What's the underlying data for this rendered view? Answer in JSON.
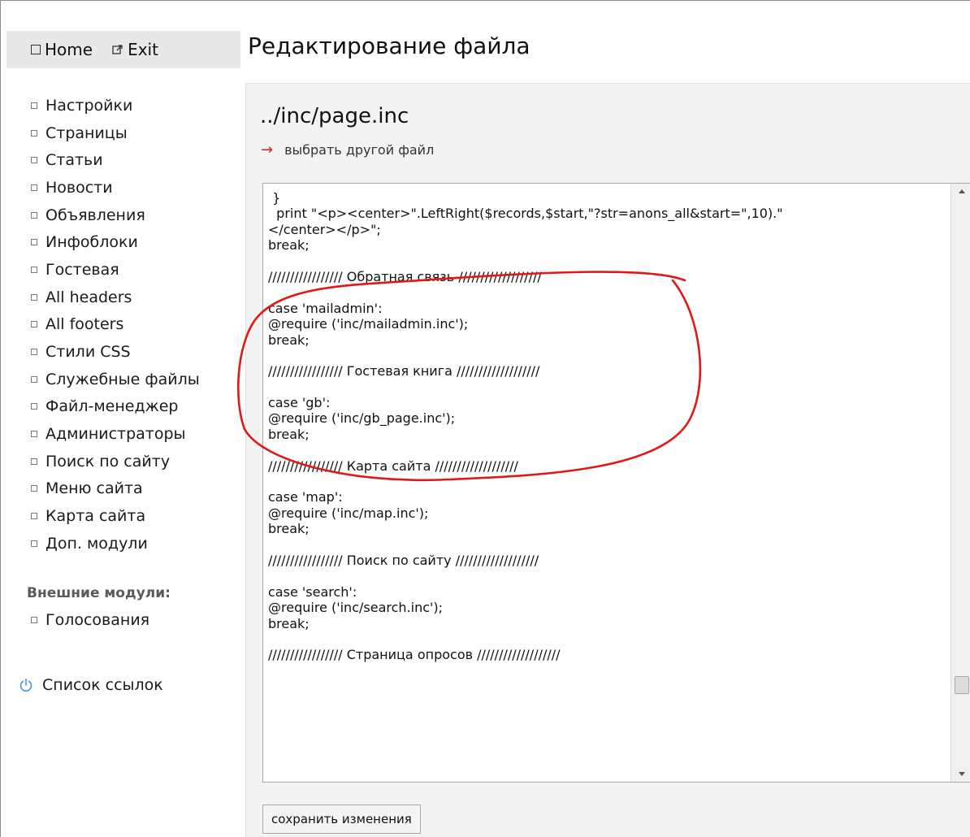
{
  "topnav": {
    "home_label": "Home",
    "exit_label": "Exit"
  },
  "page_title": "Редактирование файла",
  "sidebar": {
    "items": [
      "Настройки",
      "Страницы",
      "Статьи",
      "Новости",
      "Объявления",
      "Инфоблоки",
      "Гостевая",
      "All headers",
      "All footers",
      "Стили CSS",
      "Служебные файлы",
      "Файл-менеджер",
      "Администраторы",
      "Поиск по сайту",
      "Меню сайта",
      "Карта сайта",
      "Доп. модули"
    ],
    "external_label": "Внешние модули:",
    "external_items": [
      "Голосования"
    ],
    "links_label": "Список ссылок"
  },
  "editor": {
    "file_path": "../inc/page.inc",
    "choose_other": "выбрать другой файл",
    "code_lines": [
      " }",
      "  print \"<p><center>\".LeftRight($records,$start,\"?str=anons_all&start=\",10).\"",
      "</center></p>\";",
      "break;",
      "",
      "///////////////// Обратная связь ///////////////////",
      "",
      "case 'mailadmin':",
      "@require ('inc/mailadmin.inc');",
      "break;",
      "",
      "///////////////// Гостевая книга ///////////////////",
      "",
      "case 'gb':",
      "@require ('inc/gb_page.inc');",
      "break;",
      "",
      "///////////////// Карта сайта ///////////////////",
      "",
      "case 'map':",
      "@require ('inc/map.inc');",
      "break;",
      "",
      "///////////////// Поиск по сайту ///////////////////",
      "",
      "case 'search':",
      "@require ('inc/search.inc');",
      "break;",
      "",
      "///////////////// Страница опросов ///////////////////",
      ""
    ],
    "save_label": "сохранить изменения"
  },
  "colors": {
    "accent_arrow": "#d42020",
    "annotation": "#e01818",
    "nav_bg": "#e8e8e8",
    "panel_bg": "#f3f3f3"
  }
}
